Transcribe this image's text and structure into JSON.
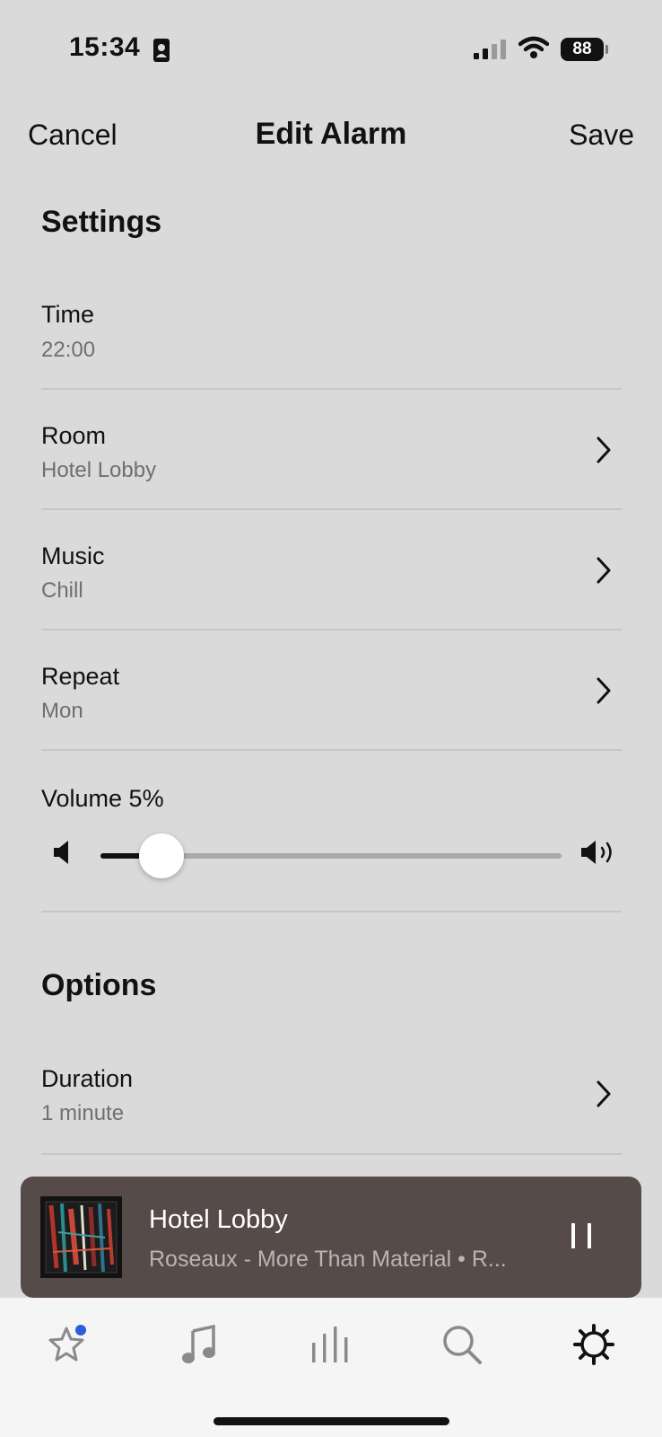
{
  "status_bar": {
    "time": "15:34",
    "battery": "88"
  },
  "nav": {
    "cancel_label": "Cancel",
    "title": "Edit Alarm",
    "save_label": "Save"
  },
  "settings": {
    "section_title": "Settings",
    "rows": [
      {
        "label": "Time",
        "value": "22:00"
      },
      {
        "label": "Room",
        "value": "Hotel Lobby"
      },
      {
        "label": "Music",
        "value": "Chill"
      },
      {
        "label": "Repeat",
        "value": "Mon"
      }
    ],
    "volume": {
      "label": "Volume 5%",
      "level_percent": 5
    }
  },
  "options": {
    "section_title": "Options",
    "rows": [
      {
        "label": "Duration",
        "value": "1 minute"
      }
    ]
  },
  "mini_player": {
    "title": "Hotel Lobby",
    "subtitle": "Roseaux - More Than Material • R..."
  },
  "tab_bar": {
    "items": [
      {
        "icon": "star-icon",
        "badge": true
      },
      {
        "icon": "music-note-icon"
      },
      {
        "icon": "rooms-bars-icon"
      },
      {
        "icon": "search-icon"
      },
      {
        "icon": "settings-gear-icon",
        "active": true
      }
    ]
  },
  "colors": {
    "background": "#dadada",
    "player_background": "#574b4a",
    "badge": "#2c5ddb",
    "tab_bar": "#f5f5f5"
  }
}
